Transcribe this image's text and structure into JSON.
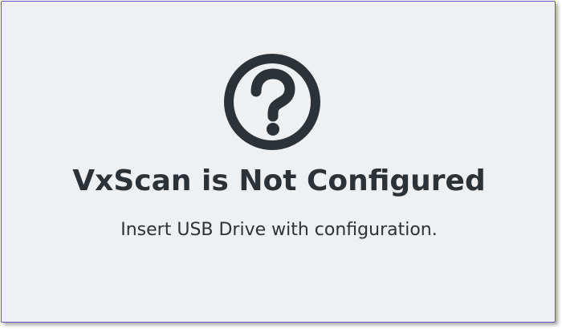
{
  "icon": {
    "name": "question-circle-icon",
    "color": "#2b3238"
  },
  "screen": {
    "title": "VxScan is Not Configured",
    "message": "Insert USB Drive with configuration.",
    "background": "#eff0f2",
    "border_color": "#6f55c4"
  }
}
